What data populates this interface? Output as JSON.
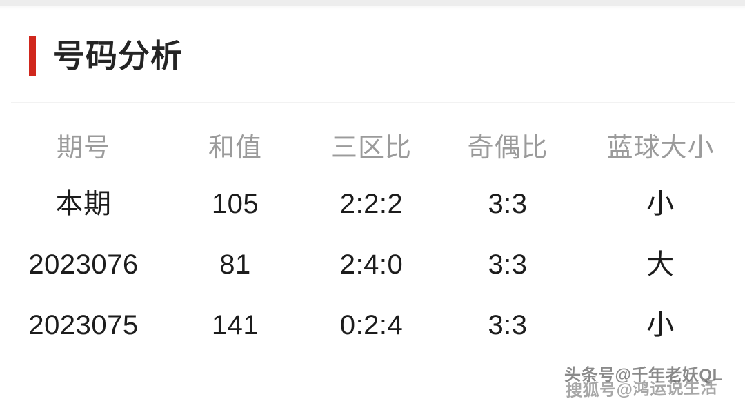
{
  "section": {
    "title": "号码分析",
    "accent_color": "#d0271d"
  },
  "table": {
    "headers": [
      "期号",
      "和值",
      "三区比",
      "奇偶比",
      "蓝球大小"
    ],
    "rows": [
      {
        "issue": "本期",
        "sum": "105",
        "zone_ratio": "2:2:2",
        "odd_even_ratio": "3:3",
        "blue_ball_size": "小"
      },
      {
        "issue": "2023076",
        "sum": "81",
        "zone_ratio": "2:4:0",
        "odd_even_ratio": "3:3",
        "blue_ball_size": "大"
      },
      {
        "issue": "2023075",
        "sum": "141",
        "zone_ratio": "0:2:4",
        "odd_even_ratio": "3:3",
        "blue_ball_size": "小"
      }
    ]
  },
  "watermarks": {
    "toutiao": "头条号@千年老妖QL",
    "sohu": "搜狐号@鸿运说生活"
  }
}
